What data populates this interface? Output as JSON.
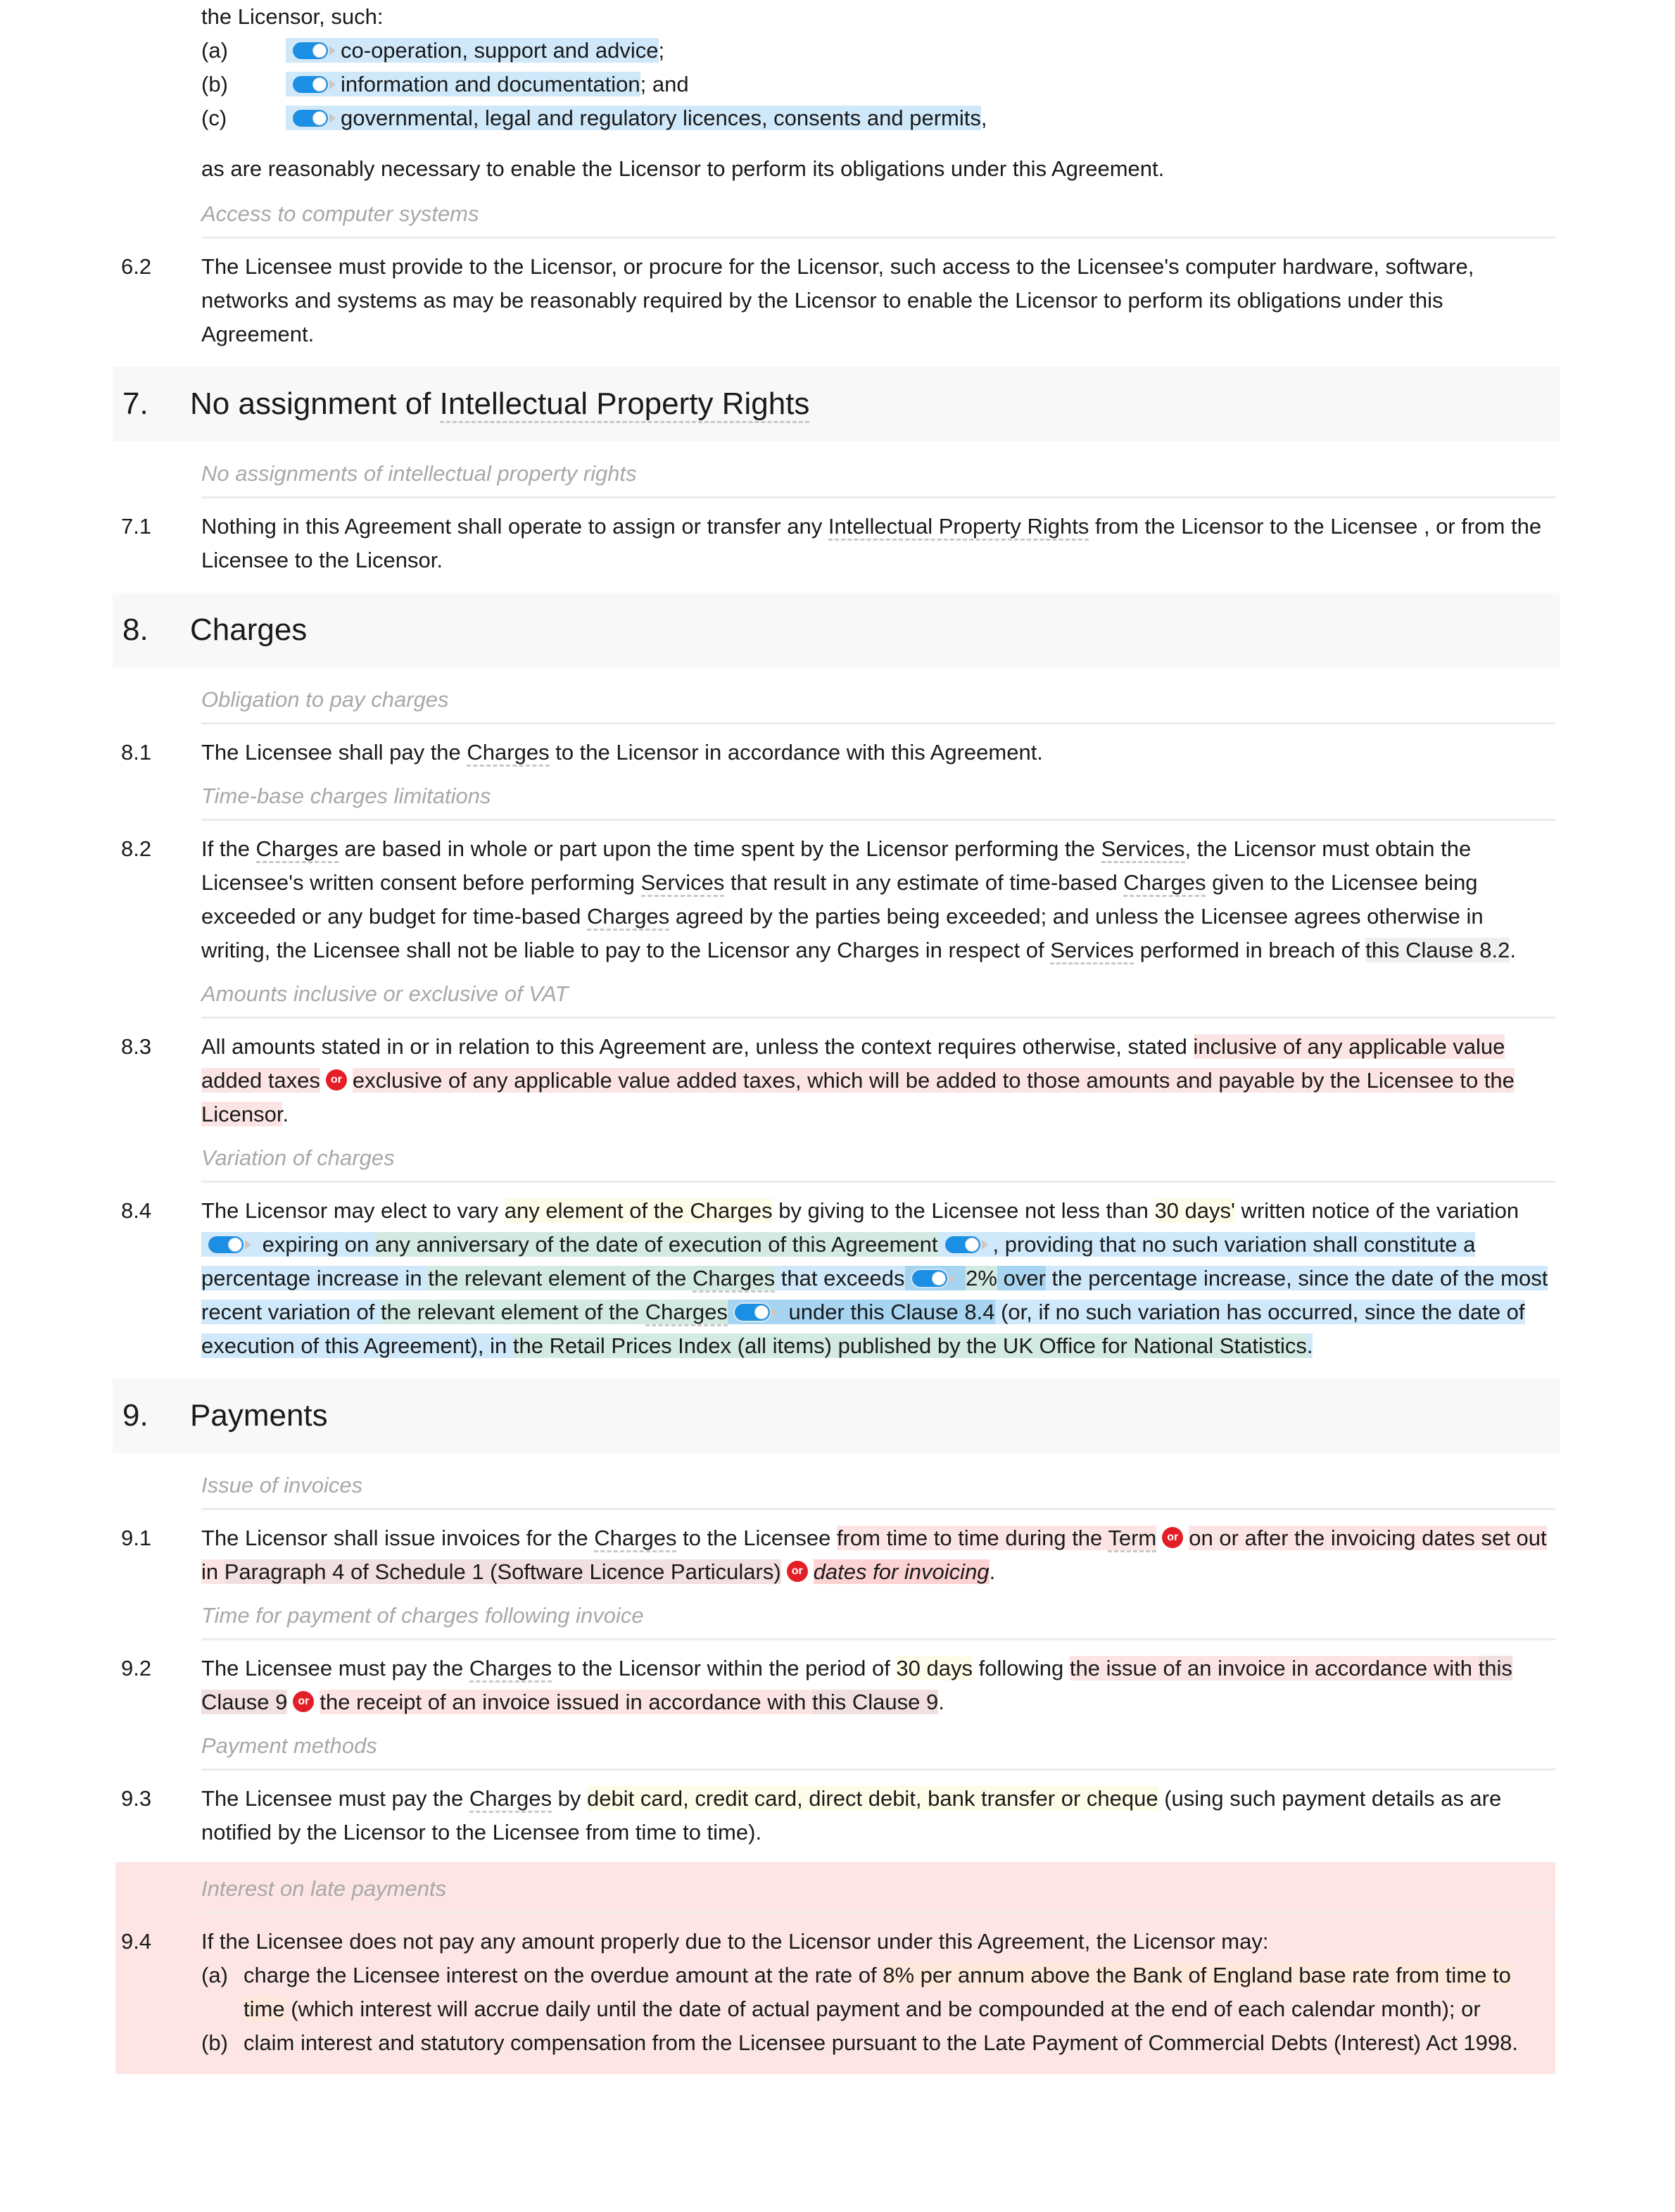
{
  "intro": {
    "lead": "the Licensor, such:",
    "items": [
      {
        "letter": "(a)",
        "text": "co-operation, support and advice",
        "suffix": ";"
      },
      {
        "letter": "(b)",
        "text": "information and documentation",
        "suffix": "; and"
      },
      {
        "letter": "(c)",
        "text": "governmental, legal and regulatory licences, consents and permits",
        "suffix": ","
      }
    ],
    "trailer": "as are reasonably necessary to enable the Licensor to perform its obligations under this Agreement."
  },
  "clause_6_2": {
    "label": "Access to computer systems",
    "number": "6.2",
    "text": "The Licensee must provide to the Licensor, or procure for the Licensor, such access to the Licensee's computer hardware, software, networks and systems as may be reasonably required by the Licensor to enable the Licensor to perform its obligations under this Agreement."
  },
  "section_7": {
    "number": "7.",
    "title_pre": "No assignment of ",
    "title_term": "Intellectual Property Rights",
    "clause_7_1": {
      "label": "No assignments of intellectual property rights",
      "number": "7.1",
      "pre": "Nothing in this Agreement shall operate to assign or transfer any ",
      "term": "Intellectual Property Rights",
      "post": " from the Licensor to the Licensee , or from the Licensee to the Licensor."
    }
  },
  "section_8": {
    "number": "8.",
    "title": "Charges",
    "clause_8_1": {
      "label": "Obligation to pay charges",
      "number": "8.1",
      "pre": "The Licensee shall pay the ",
      "term": "Charges",
      "post": " to the Licensor in accordance with this Agreement."
    },
    "clause_8_2": {
      "label": "Time-base charges limitations",
      "number": "8.2",
      "parts": [
        "If the ",
        "Charges",
        " are based in whole or part upon the time spent by the Licensor performing the ",
        "Services",
        ", the Licensor must obtain the Licensee's written consent before performing ",
        "Services",
        " that result in any estimate of time-based ",
        "Charges",
        " given to the Licensee being exceeded or any budget for time-based ",
        "Charges",
        " agreed by the parties being exceeded; and unless the Licensee agrees otherwise in writing, the Licensee shall not be liable to pay to the Licensor any Charges in respect of ",
        "Services",
        " performed in breach of ",
        "this Clause 8.2",
        "."
      ]
    },
    "clause_8_3": {
      "label": "Amounts inclusive or exclusive of VAT",
      "number": "8.3",
      "pre": "All amounts stated in or in relation to this Agreement are, unless the context requires otherwise, stated ",
      "option_a": "inclusive of any applicable value added taxes",
      "or_label": "or",
      "option_b": "exclusive of any applicable value added taxes, which will be added to those amounts and payable by the Licensee to the Licensor",
      "post": "."
    },
    "clause_8_4": {
      "label": "Variation of charges",
      "number": "8.4",
      "p1": "The Licensor may elect to vary ",
      "var1": "any element of the Charges",
      "p2": " by giving to the Licensee not less than ",
      "var2": "30 days'",
      "p3": " written notice of the variation",
      "p4": " expiring on ",
      "var3": "any anniversary of the date of execution of this Agreement",
      "p5": ", providing that no such variation shall constitute a percentage increase in ",
      "var4a": "the relevant element of the ",
      "var4term": "Charges",
      "p6": " that exceeds",
      "var5": "2%",
      "p7": " over",
      "p8": " the percentage increase, since the date of the most recent variation of ",
      "var6a": "the relevant element of the ",
      "var6term": "Charges",
      "p9": " under this ",
      "var7": "Clause 8.4",
      "p10": " (or, if no such variation has occurred, since the date of execution of this Agreement), in ",
      "var8": "the Retail Prices Index (all items) published by the UK Office for National Statistics",
      "p11": "."
    }
  },
  "section_9": {
    "number": "9.",
    "title": "Payments",
    "clause_9_1": {
      "label": "Issue of invoices",
      "number": "9.1",
      "pre": "The Licensor shall issue invoices for the ",
      "term": "Charges",
      "mid": " to the Licensee ",
      "opt1_pre": "from time to time during the ",
      "opt1_term": "Term",
      "or1": "or",
      "opt2_pre": "on or after the invoicing dates set out in ",
      "opt2_ref": "Paragraph 4 of Schedule 1 (Software Licence Particulars)",
      "or2": "or",
      "opt3": "dates for invoicing",
      "post": "."
    },
    "clause_9_2": {
      "label": "Time for payment of charges following invoice",
      "number": "9.2",
      "pre": "The Licensee must pay the ",
      "term": "Charges",
      "mid": " to the Licensor within the period of ",
      "days": "30 days",
      "mid2": " following ",
      "opt1_pre": "the issue of an invoice in accordance with ",
      "opt1_ref": "this Clause 9",
      "or": "or",
      "opt2_pre": "the receipt of an invoice issued in accordance with ",
      "opt2_ref": "this Clause 9",
      "post": "."
    },
    "clause_9_3": {
      "label": "Payment methods",
      "number": "9.3",
      "pre": "The Licensee must pay the ",
      "term": "Charges",
      "mid": " by ",
      "methods": "debit card, credit card, direct debit, bank transfer or cheque",
      "post": " (using such payment details as are notified by the Licensor to the Licensee from time to time)."
    },
    "clause_9_4": {
      "label": "Interest on late payments",
      "number": "9.4",
      "lead": "If the Licensee does not pay any amount properly due to the Licensor under this Agreement, the Licensor may:",
      "a_letter": "(a)",
      "a_pre": "charge the Licensee interest on the overdue amount at the rate of ",
      "a_rate": "8% per annum above the Bank of England base rate from time to time",
      "a_post": " (which interest will accrue daily until the date of actual payment and be compounded at the end of each calendar month); or",
      "b_letter": "(b)",
      "b_text": "claim interest and statutory compensation from the Licensee pursuant to the Late Payment of Commercial Debts (Interest) Act 1998."
    }
  }
}
